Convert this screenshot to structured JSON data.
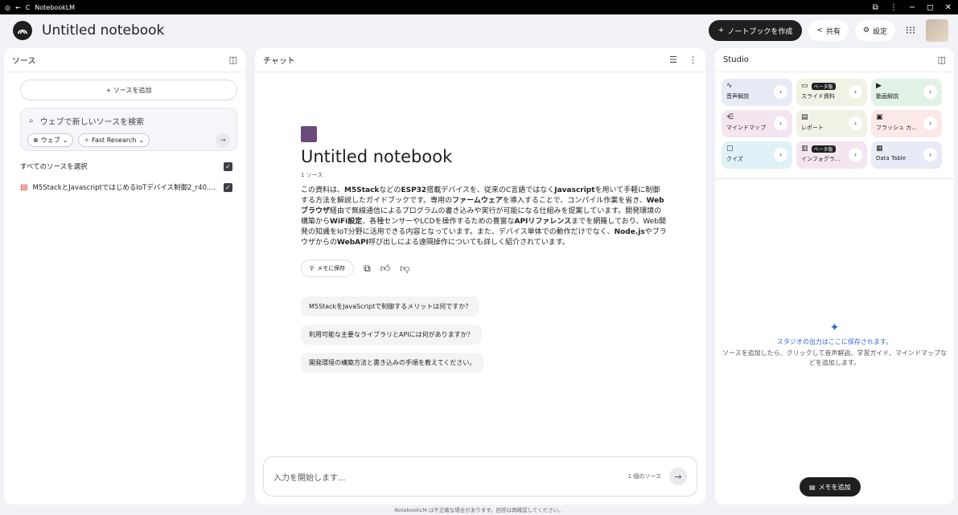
{
  "titlebar": {
    "app_name": "NotebookLM",
    "back": "←",
    "reload": "C",
    "settings": "⋮",
    "minimize": "−",
    "maximize": "◻",
    "close": "✕"
  },
  "header": {
    "title": "Untitled notebook",
    "create_label": "ノートブックを作成",
    "share_label": "共有",
    "settings_label": "設定"
  },
  "sources": {
    "title": "ソース",
    "add_label": "ソースを追加",
    "search_placeholder": "ウェブで新しいソースを検索",
    "chip_web": "ウェブ",
    "chip_research": "Fast Research",
    "select_all": "すべてのソースを選択",
    "items": [
      {
        "label": "M5StackとJavascriptではじめるIoTデバイス制御2_r40...."
      }
    ]
  },
  "chat": {
    "title": "チャット",
    "notebook_title": "Untitled notebook",
    "source_count": "1 ソース",
    "summary_parts": [
      {
        "t": "この資料は、",
        "b": false
      },
      {
        "t": "M5Stack",
        "b": true
      },
      {
        "t": "などの",
        "b": false
      },
      {
        "t": "ESP32",
        "b": true
      },
      {
        "t": "搭載デバイスを、従来のC言語ではなく",
        "b": false
      },
      {
        "t": "Javascript",
        "b": true
      },
      {
        "t": "を用いて手軽に制御する方法を解説したガイドブックです。専用の",
        "b": false
      },
      {
        "t": "ファームウェア",
        "b": true
      },
      {
        "t": "を導入することで、コンパイル作業を省き、",
        "b": false
      },
      {
        "t": "Webブラウザ",
        "b": true
      },
      {
        "t": "経由で無線通信によるプログラムの書き込みや実行が可能になる仕組みを提案しています。開発環境の構築から",
        "b": false
      },
      {
        "t": "WiFi設定",
        "b": true
      },
      {
        "t": "、各種センサーやLCDを操作するための豊富な",
        "b": false
      },
      {
        "t": "APIリファレンス",
        "b": true
      },
      {
        "t": "までを網羅しており、Web開発の知識をIoT分野に活用できる内容となっています。また、デバイス単体での動作だけでなく、",
        "b": false
      },
      {
        "t": "Node.js",
        "b": true
      },
      {
        "t": "やブラウザからの",
        "b": false
      },
      {
        "t": "WebAPI",
        "b": true
      },
      {
        "t": "呼び出しによる遠隔操作についても詳しく紹介されています。",
        "b": false
      }
    ],
    "save_label": "メモに保存",
    "suggestions": [
      "M5StackをJavaScriptで制御するメリットは何ですか？",
      "利用可能な主要なライブラリとAPIには何がありますか？",
      "開発環境の構築方法と書き込みの手順を教えてください。"
    ],
    "input_placeholder": "入力を開始します...",
    "input_count": "1 個のソース"
  },
  "studio": {
    "title": "Studio",
    "tiles": [
      {
        "label": "音声解説",
        "icon": "audio-icon",
        "bg": "#e8eaf6",
        "beta": ""
      },
      {
        "label": "スライド資料",
        "icon": "slides-icon",
        "bg": "#f1f1e6",
        "beta": "ベータ版"
      },
      {
        "label": "動画解説",
        "icon": "video-icon",
        "bg": "#e3f2e6",
        "beta": ""
      },
      {
        "label": "マインドマップ",
        "icon": "mindmap-icon",
        "bg": "#f4e6f1",
        "beta": ""
      },
      {
        "label": "レポート",
        "icon": "report-icon",
        "bg": "#f1f1e6",
        "beta": ""
      },
      {
        "label": "フラッシュ カ...",
        "icon": "flashcard-icon",
        "bg": "#fce8e6",
        "beta": ""
      },
      {
        "label": "クイズ",
        "icon": "quiz-icon",
        "bg": "#e0f2f7",
        "beta": ""
      },
      {
        "label": "インフォグラ...",
        "icon": "infographic-icon",
        "bg": "#f4e6f1",
        "beta": "ベータ版"
      },
      {
        "label": "Data Table",
        "icon": "table-icon",
        "bg": "#e8eaf6",
        "beta": ""
      }
    ],
    "empty_heading": "スタジオの出力はここに保存されます。",
    "empty_desc": "ソースを追加したら、クリックして音声解説、学習ガイド、マインドマップなどを追加します。",
    "memo_label": "メモを追加"
  },
  "footer": "NotebookLM は不正確な場合があります。回答は再確認してください。"
}
